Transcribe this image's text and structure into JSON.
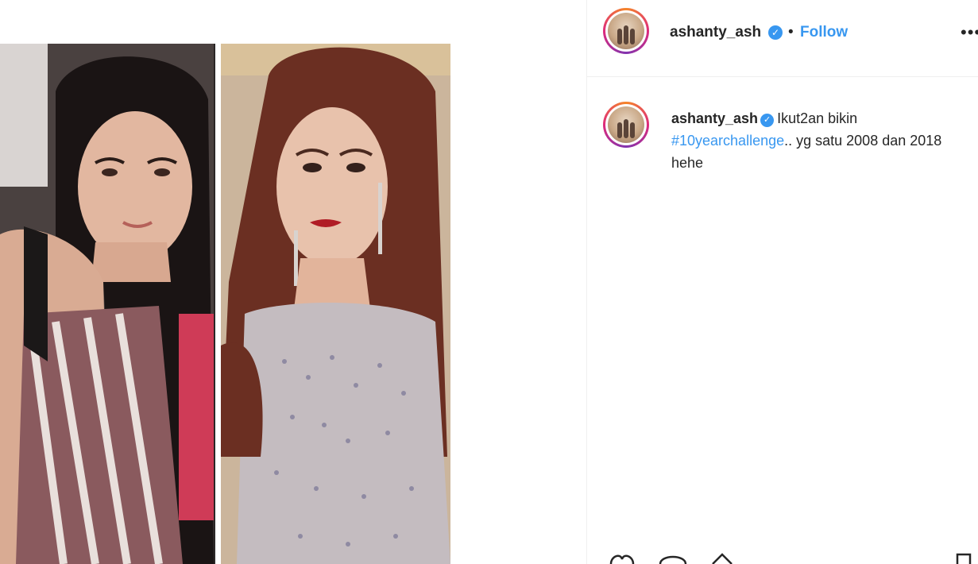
{
  "post": {
    "username": "ashanty_ash",
    "separator": "•",
    "follow_label": "Follow",
    "more_label": "•••",
    "verified_mark": "✓"
  },
  "caption": {
    "username": "ashanty_ash",
    "text_before": "Ikut2an bikin ",
    "hashtag": "#10yearchallenge",
    "text_after": ".. yg satu 2008 dan 2018 hehe"
  },
  "icons": {
    "like": "heart-icon",
    "comment": "comment-icon",
    "share": "share-icon",
    "save": "bookmark-icon",
    "verified": "verified-badge-icon",
    "more": "more-options-icon"
  },
  "colors": {
    "accent": "#3897f0",
    "text": "#262626",
    "divider": "#efefef"
  }
}
